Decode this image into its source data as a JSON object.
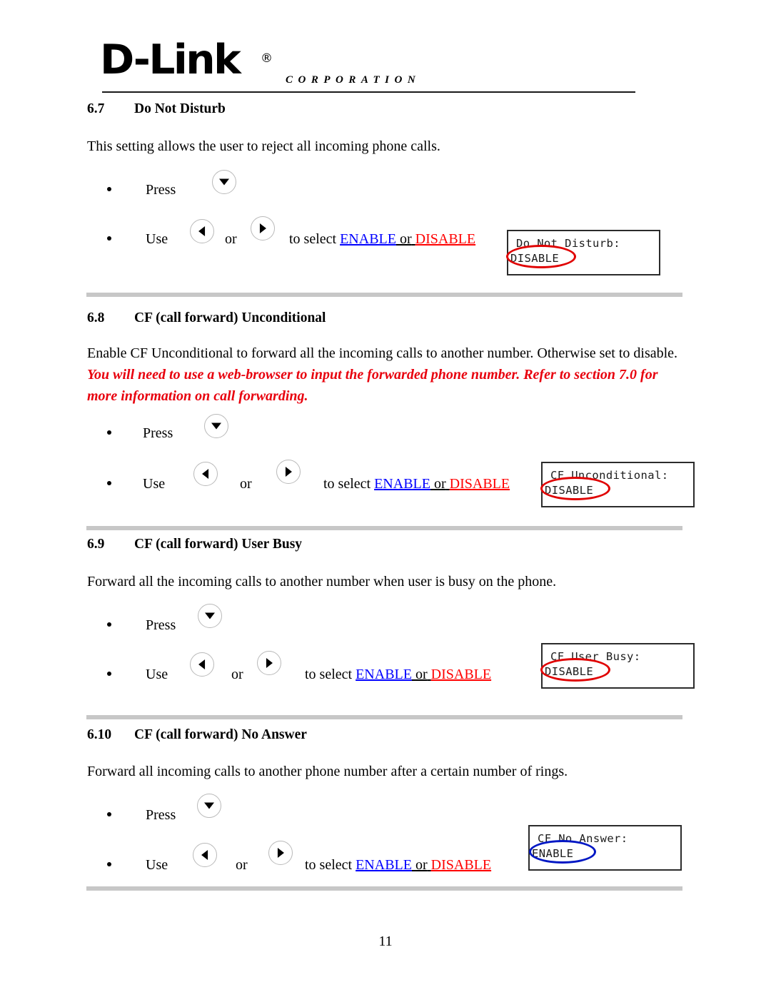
{
  "document": {
    "page_number": "11"
  },
  "header": {
    "logo_wordmark": "D-Link",
    "logo_registered": "®",
    "logo_subtitle": "CORPORATION"
  },
  "common": {
    "press_label": "Press",
    "use_label": "Use",
    "or_label": "or",
    "to_select_label": "to select",
    "enable_label": "ENABLE",
    "or_inline_label": "or",
    "disable_label": "DISABLE",
    "down_key": "down-arrow-key",
    "left_key": "left-arrow-key",
    "right_key": "right-arrow-key"
  },
  "colors": {
    "enable_blue": "#0000ff",
    "disable_red": "#ff0000",
    "warning_red": "#e8000d",
    "annotation_red": "#e00000",
    "annotation_blue": "#0017c4",
    "divider_gray": "#c7c7c7"
  },
  "sections": [
    {
      "number": "6.7",
      "title": "Do Not Disturb",
      "body": "This setting allows the user to reject all incoming phone calls.",
      "lcd": {
        "line1": "Do Not Disturb:",
        "line2": "DISABLE",
        "highlight_color": "red"
      }
    },
    {
      "number": "6.8",
      "title": "CF (call forward) Unconditional",
      "body_part1": "Enable CF Unconditional to forward all the incoming calls to another number. Otherwise set to disable.",
      "body_part2": "You will need to use a web-browser to input the forwarded phone number. Refer to section 7.0 for more information on call forwarding.",
      "lcd": {
        "line1": "CF Unconditional:",
        "line2": "DISABLE",
        "highlight_color": "red"
      }
    },
    {
      "number": "6.9",
      "title": "CF (call forward) User Busy",
      "body": "Forward all the incoming calls to another number when user is busy on the phone.",
      "lcd": {
        "line1": "CF User Busy:",
        "line2": "DISABLE",
        "highlight_color": "red"
      }
    },
    {
      "number": "6.10",
      "title": "CF (call forward) No Answer",
      "body": "Forward all incoming calls to another phone number after a certain number of rings.",
      "lcd": {
        "line1": "CF No Answer:",
        "line2": "ENABLE",
        "highlight_color": "blue"
      }
    }
  ]
}
